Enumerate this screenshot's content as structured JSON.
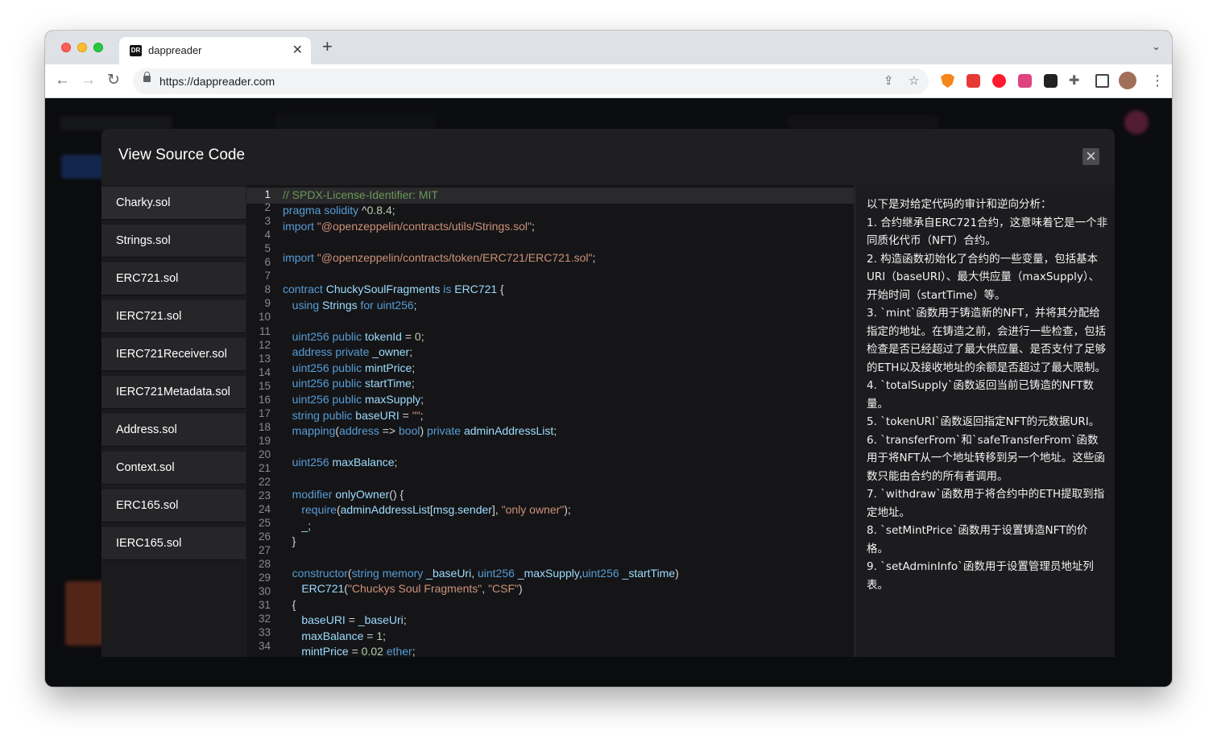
{
  "browser": {
    "tab_title": "dappreader",
    "favicon_text": "DR",
    "url": "https://dappreader.com",
    "icons": [
      "back-icon",
      "forward-icon",
      "reload-icon",
      "lock-icon",
      "share-icon",
      "bookmark-star-icon",
      "metamask-extension-icon",
      "extension-red-icon",
      "opera-extension-icon",
      "extension-pink-icon",
      "extension-dark-icon",
      "extensions-puzzle-icon",
      "sidebar-icon",
      "profile-avatar",
      "more-menu-icon"
    ]
  },
  "modal": {
    "title": "View Source Code",
    "close_glyph": "✕",
    "files": [
      {
        "label": "Charky.sol",
        "active": true
      },
      {
        "label": "Strings.sol"
      },
      {
        "label": "ERC721.sol"
      },
      {
        "label": "IERC721.sol"
      },
      {
        "label": "IERC721Receiver.sol"
      },
      {
        "label": "IERC721Metadata.sol"
      },
      {
        "label": "Address.sol"
      },
      {
        "label": "Context.sol"
      },
      {
        "label": "ERC165.sol"
      },
      {
        "label": "IERC165.sol"
      }
    ],
    "current_line": 1,
    "code_lines": [
      "// SPDX-License-Identifier: MIT",
      "pragma solidity ^0.8.4;",
      "import \"@openzeppelin/contracts/utils/Strings.sol\";",
      "",
      "",
      "import \"@openzeppelin/contracts/token/ERC721/ERC721.sol\";",
      "",
      "contract ChuckySoulFragments is ERC721 {",
      "   using Strings for uint256;",
      "",
      "",
      "   uint256 public tokenId = 0;",
      "   address private _owner;",
      "   uint256 public mintPrice;",
      "   uint256 public startTime;",
      "   uint256 public maxSupply;",
      "   string public baseURI = \"\";",
      "   mapping(address => bool) private adminAddressList;",
      "",
      "   uint256 maxBalance;",
      "",
      "",
      "   modifier onlyOwner() {",
      "      require(adminAddressList[msg.sender], \"only owner\");",
      "      _;",
      "   }",
      "",
      "",
      "   constructor(string memory _baseUri, uint256 _maxSupply,uint256 _startTime)",
      "      ERC721(\"Chuckys Soul Fragments\", \"CSF\")",
      "   {",
      "      baseURI = _baseUri;",
      "      maxBalance = 1;",
      "      mintPrice = 0.02 ether;"
    ],
    "analysis_text": "以下是对给定代码的审计和逆向分析：\n1. 合约继承自ERC721合约，这意味着它是一个非同质化代币（NFT）合约。\n2. 构造函数初始化了合约的一些变量，包括基本URI（baseURI）、最大供应量（maxSupply）、开始时间（startTime）等。\n3. `mint`函数用于铸造新的NFT，并将其分配给指定的地址。在铸造之前，会进行一些检查，包括检查是否已经超过了最大供应量、是否支付了足够的ETH以及接收地址的余额是否超过了最大限制。\n4. `totalSupply`函数返回当前已铸造的NFT数量。\n5. `tokenURI`函数返回指定NFT的元数据URI。\n6. `transferFrom`和`safeTransferFrom`函数用于将NFT从一个地址转移到另一个地址。这些函数只能由合约的所有者调用。\n7. `withdraw`函数用于将合约中的ETH提取到指定地址。\n8. `setMintPrice`函数用于设置铸造NFT的价格。\n9. `setAdminInfo`函数用于设置管理员地址列表。"
  },
  "colors": {
    "modal_bg": "#1f1f22",
    "editor_bg": "#151517",
    "comment": "#6a9955",
    "keyword": "#569cd6",
    "string": "#ce9178",
    "number": "#b5cea8",
    "identifier": "#9cdcfe"
  }
}
